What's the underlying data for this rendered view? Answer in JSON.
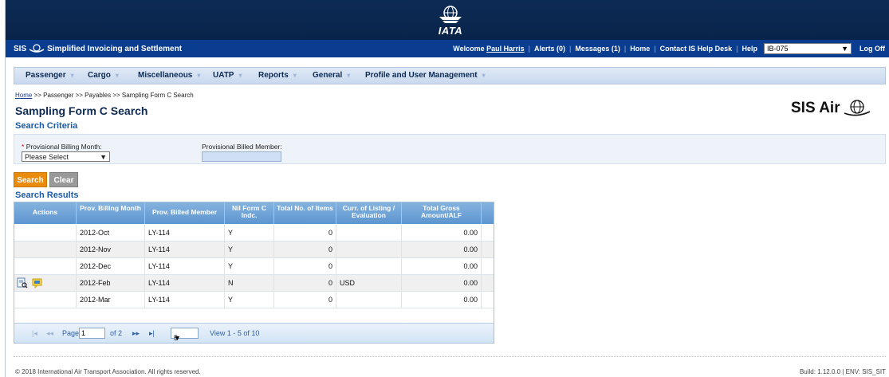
{
  "header": {
    "logo_text": "IATA"
  },
  "sis_bar": {
    "title": "Simplified Invoicing and Settlement",
    "logo_text": "SIS",
    "welcome": "Welcome",
    "user": "Paul Harris",
    "alerts": "Alerts (0)",
    "messages": "Messages (1)",
    "home": "Home",
    "contact": "Contact IS Help Desk",
    "help": "Help",
    "member_value": "IB-075",
    "logoff": "Log Off"
  },
  "menu": [
    "Passenger",
    "Cargo",
    "Miscellaneous",
    "UATP",
    "Reports",
    "General",
    "Profile and User Management"
  ],
  "breadcrumb": {
    "home": "Home",
    "rest": ">> Passenger >> Payables >> Sampling Form C Search"
  },
  "page_title": "Sampling Form C Search",
  "brand": "SIS Air",
  "criteria": {
    "title": "Search Criteria",
    "billing_month_label": "Provisional Billing Month:",
    "billing_month_value": "Please Select",
    "billed_member_label": "Provisional Billed Member:",
    "required_mark": "*"
  },
  "buttons": {
    "search": "Search",
    "clear": "Clear"
  },
  "results": {
    "title": "Search Results",
    "columns": [
      "Actions",
      "Prov. Billing Month",
      "Prov. Billed Member",
      "Nil Form C Indc.",
      "Total No. of Items",
      "Curr. of Listing / Evaluation",
      "Total Gross Amount/ALF"
    ],
    "rows": [
      {
        "month": "2012-Oct",
        "member": "LY-114",
        "nil": "Y",
        "items": "0",
        "curr": "",
        "amount": "0.00",
        "has_actions": false
      },
      {
        "month": "2012-Nov",
        "member": "LY-114",
        "nil": "Y",
        "items": "0",
        "curr": "",
        "amount": "0.00",
        "has_actions": false
      },
      {
        "month": "2012-Dec",
        "member": "LY-114",
        "nil": "Y",
        "items": "0",
        "curr": "",
        "amount": "0.00",
        "has_actions": false
      },
      {
        "month": "2012-Feb",
        "member": "LY-114",
        "nil": "N",
        "items": "0",
        "curr": "USD",
        "amount": "0.00",
        "has_actions": true
      },
      {
        "month": "2012-Mar",
        "member": "LY-114",
        "nil": "Y",
        "items": "0",
        "curr": "",
        "amount": "0.00",
        "has_actions": false
      }
    ],
    "pager": {
      "page_label": "Page",
      "page_value": "1",
      "of_label": "of 2",
      "page_size": "5",
      "view_text": "View 1 - 5 of 10"
    }
  },
  "footer": {
    "copyright": "© 2018 International Air Transport Association. All rights reserved.",
    "build": "Build: 1.12.0.0 | ENV: SIS_SIT"
  },
  "colors": {
    "header_navy": "#0c2b55",
    "sis_blue": "#0a3d8f",
    "search_orange": "#eb8b0e",
    "grid_header": "#5d95cf"
  }
}
